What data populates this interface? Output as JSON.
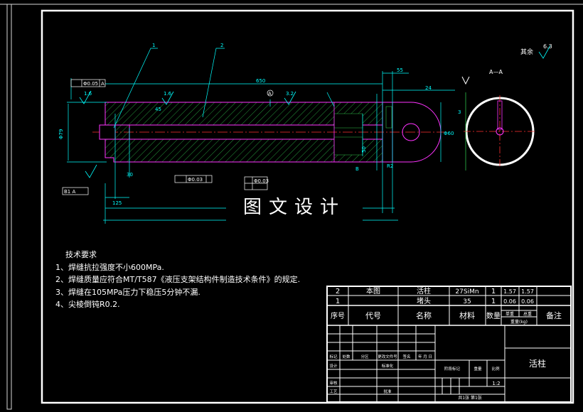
{
  "tech": {
    "title": "技术要求",
    "items": [
      "1、焊缝抗拉强度不小600MPa.",
      "2、焊缝质量应符合MT/T587《液压支架结构件制造技术条件》的规定.",
      "3、焊缝在105MPa压力下稳压5分钟不漏.",
      "4、尖棱倒钝R0.2."
    ]
  },
  "watermark": "图文设计",
  "section_label": "A—A",
  "roughness_note": "其余",
  "roughness_value": "6.3",
  "callouts": {
    "c1": "1",
    "c2": "2"
  },
  "dims": {
    "d55": "55",
    "d24": "24",
    "d125": "125",
    "d3": "3",
    "d16a": "1.6",
    "d16b": "1.6",
    "d32": "3.2",
    "tol1": "Φ0.05",
    "tol1b": "A",
    "tolA": "A",
    "ctr": "Φ0.03",
    "flat": "Φ0.03",
    "bref": "B",
    "r2": "R2",
    "d30": "30",
    "d45": "45",
    "d60": "Φ60",
    "d80": "Φ80",
    "dia": "Φ79",
    "len": "650",
    "d50": "50",
    "bA": "B1 A"
  },
  "title_block": {
    "rows": [
      {
        "no": "2",
        "code": "本图",
        "name": "活柱",
        "material": "27SiMn",
        "qty": "1",
        "w1": "1.57",
        "w2": "1.57"
      },
      {
        "no": "1",
        "code": "",
        "name": "堵头",
        "material": "35",
        "qty": "1",
        "w1": "0.06",
        "w2": "0.06"
      }
    ],
    "headers": {
      "no": "序号",
      "code": "代号",
      "name": "名称",
      "material": "材料",
      "qty": "数量",
      "w1": "单重",
      "w2": "总重",
      "weight": "重量(kg)",
      "remark": "备注"
    },
    "drawing_name": "活柱",
    "scale": "1:2",
    "sheet": "共1张 第1张",
    "labels": {
      "mark": "标记",
      "count": "处数",
      "zone": "分区",
      "change": "更改文件号",
      "sign": "签名",
      "date": "年 月 日",
      "design": "设计",
      "std": "标准化",
      "stage": "阶段标记",
      "weight": "重量",
      "ratio": "比例",
      "review": "审核",
      "process": "工艺",
      "approve": "批准"
    }
  }
}
